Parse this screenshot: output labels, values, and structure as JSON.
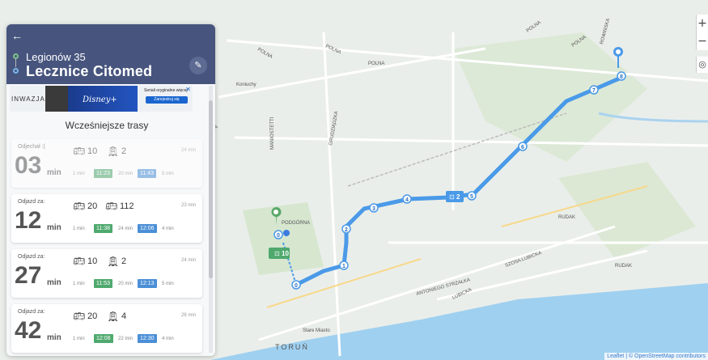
{
  "header": {
    "from": "Legionów 35",
    "to": "Lecznice Citomed"
  },
  "ad": {
    "brand": "INWAZJA",
    "service": "Disney+",
    "text": "Seriali oryginalne więcej",
    "button": "Zarejestruj się"
  },
  "earlier_routes": "Wcześniejsze trasy",
  "cards": [
    {
      "label": "Odjechał :(",
      "minutes": "03",
      "unit": "min",
      "lines": [
        "10",
        "2"
      ],
      "duration": "24 min",
      "walk1": "1 min",
      "dep": "11:23",
      "mid": "20 min",
      "arr": "11:43",
      "walk2": "5 min"
    },
    {
      "label": "Odjazd za:",
      "minutes": "12",
      "unit": "min",
      "lines": [
        "20",
        "112"
      ],
      "duration": "23 min",
      "walk1": "1 min",
      "dep": "11:38",
      "mid": "24 min",
      "arr": "12:06",
      "walk2": "4 min"
    },
    {
      "label": "Odjazd za:",
      "minutes": "27",
      "unit": "min",
      "lines": [
        "10",
        "2"
      ],
      "duration": "24 min",
      "walk1": "1 min",
      "dep": "11:53",
      "mid": "20 min",
      "arr": "12:13",
      "walk2": "5 min"
    },
    {
      "label": "Odjazd za:",
      "minutes": "42",
      "unit": "min",
      "lines": [
        "20",
        "4"
      ],
      "duration": "26 min",
      "walk1": "1 min",
      "dep": "12:08",
      "mid": "22 min",
      "arr": "12:30",
      "walk2": "4 min"
    }
  ],
  "map": {
    "labels": [
      "POLNA",
      "POLNA",
      "POLNA",
      "POLNA",
      "POLNA",
      "PODGÓRNA",
      "GRUDZIĄDZKA",
      "DŁUGA",
      "MANIOSTETTI",
      "ANTONIEGO STRZAŁKA",
      "SZOSA LUBICKA",
      "LUBICKA",
      "TORUŃ",
      "Stare Miasto",
      "Koniuchy",
      "RUDAK",
      "RUDAK",
      "ROWIŃSKA"
    ],
    "stops": [
      "0",
      "1",
      "2",
      "3",
      "4",
      "5",
      "6",
      "7",
      "8"
    ],
    "badges": [
      "10",
      "2"
    ],
    "attribution": "Leaflet | © OpenStreetMap contributors",
    "zoom_in": "+",
    "zoom_out": "−",
    "locate": "◎"
  },
  "colors": {
    "header": "#47557e",
    "route": "#4a9ae8",
    "tram_tag": "#4fa96e",
    "arr_tag": "#4b8fd6"
  }
}
